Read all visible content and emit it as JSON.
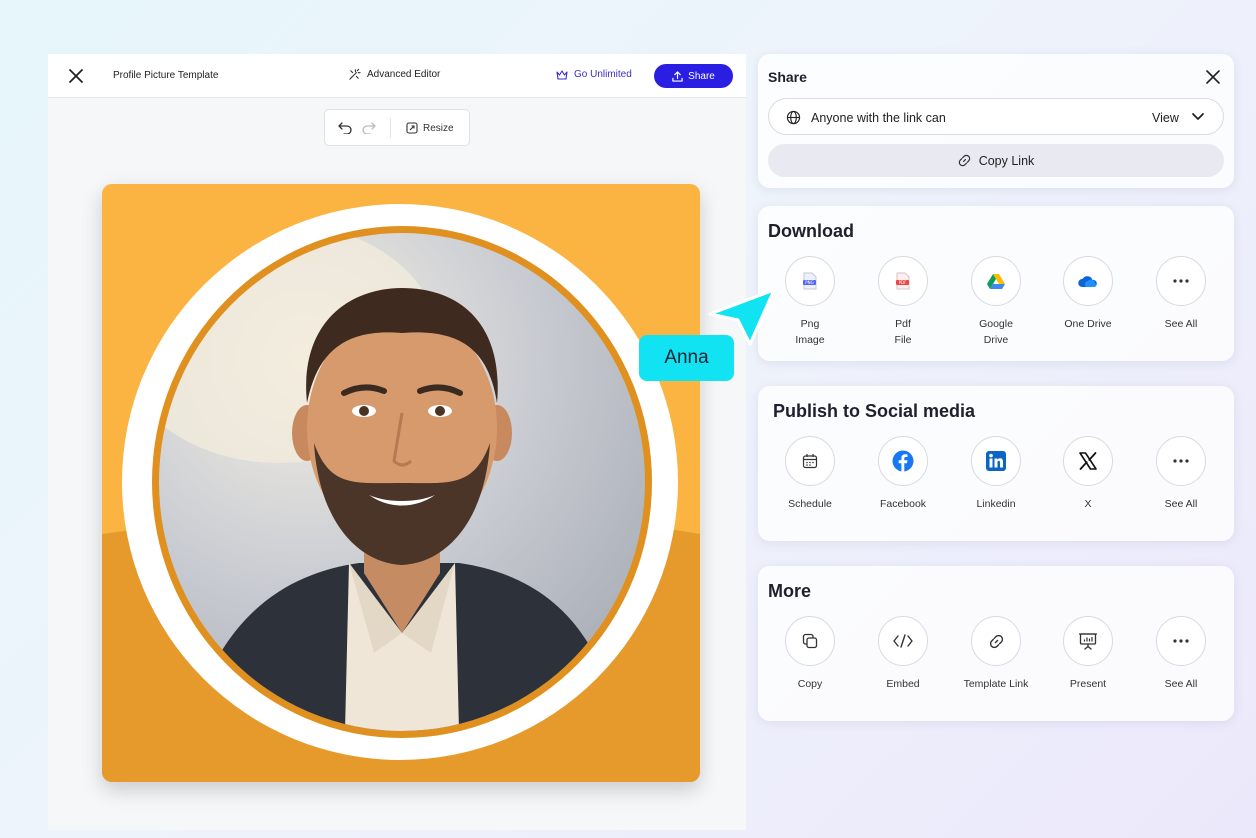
{
  "editor": {
    "title": "Profile Picture Template",
    "advanced_editor": "Advanced Editor",
    "go_unlimited": "Go Unlimited",
    "share_button": "Share",
    "resize": "Resize"
  },
  "share_panel": {
    "title": "Share",
    "access_text": "Anyone with the link can",
    "access_level": "View",
    "copy_link": "Copy Link"
  },
  "download": {
    "title": "Download",
    "options": [
      {
        "label": "Png\nImage",
        "icon": "png-file-icon"
      },
      {
        "label": "Pdf\nFile",
        "icon": "pdf-file-icon"
      },
      {
        "label": "Google\nDrive",
        "icon": "google-drive-icon"
      },
      {
        "label": "One Drive",
        "icon": "onedrive-icon"
      },
      {
        "label": "See All",
        "icon": "more-dots-icon"
      }
    ]
  },
  "social": {
    "title": "Publish to Social media",
    "options": [
      {
        "label": "Schedule",
        "icon": "calendar-icon"
      },
      {
        "label": "Facebook",
        "icon": "facebook-icon"
      },
      {
        "label": "Linkedin",
        "icon": "linkedin-icon"
      },
      {
        "label": "X",
        "icon": "x-icon"
      },
      {
        "label": "See All",
        "icon": "more-dots-icon"
      }
    ]
  },
  "more": {
    "title": "More",
    "options": [
      {
        "label": "Copy",
        "icon": "copy-icon"
      },
      {
        "label": "Embed",
        "icon": "code-icon"
      },
      {
        "label": "Template Link",
        "icon": "link-icon"
      },
      {
        "label": "Present",
        "icon": "presentation-icon"
      },
      {
        "label": "See All",
        "icon": "more-dots-icon"
      }
    ]
  },
  "collaborator": {
    "name": "Anna"
  },
  "colors": {
    "accent": "#2a1ee3",
    "go_unlimited": "#3b2ccd",
    "canvas_bg": "#fbb441",
    "canvas_accent": "#e0901f",
    "cursor": "#12e3f2"
  }
}
